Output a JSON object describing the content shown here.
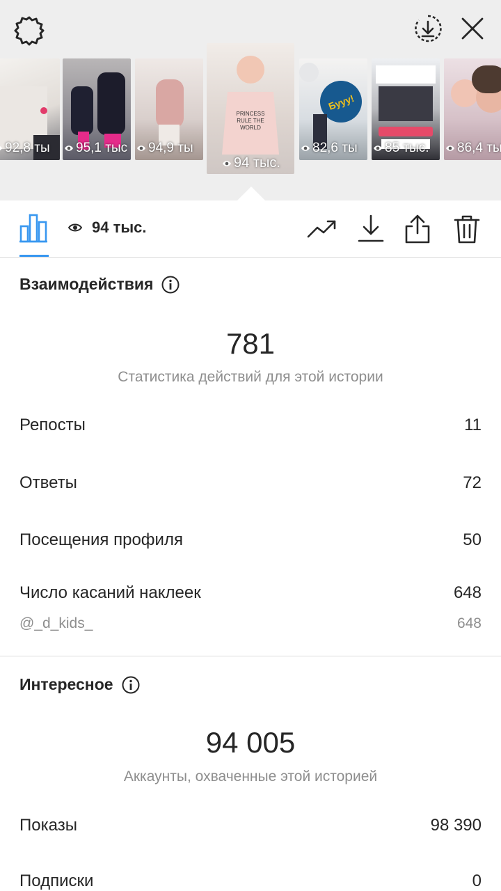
{
  "tray": {
    "stories": [
      {
        "views": "92,8 ты",
        "selected": false
      },
      {
        "views": "95,1 тыс",
        "selected": false
      },
      {
        "views": "94,9 ты",
        "selected": false
      },
      {
        "views": "94 тыс.",
        "selected": true
      },
      {
        "views": "82,6 ты",
        "selected": false
      },
      {
        "views": "85 тыс.",
        "selected": false
      },
      {
        "views": "86,4 ты",
        "selected": false
      }
    ]
  },
  "toolbar": {
    "views_total": "94 тыс."
  },
  "interactions": {
    "title": "Взаимодействия",
    "total": "781",
    "subtitle": "Статистика действий для этой истории",
    "rows": [
      {
        "label": "Репосты",
        "value": "11"
      },
      {
        "label": "Ответы",
        "value": "72"
      },
      {
        "label": "Посещения профиля",
        "value": "50"
      },
      {
        "label": "Число касаний наклеек",
        "value": "648"
      }
    ],
    "sticker": {
      "label": "@_d_kids_",
      "value": "648"
    }
  },
  "discovery": {
    "title": "Интересное",
    "total": "94 005",
    "subtitle": "Аккаунты, охваченные этой историей",
    "rows": [
      {
        "label": "Показы",
        "value": "98 390"
      },
      {
        "label": "Подписки",
        "value": "0"
      }
    ]
  },
  "colors": {
    "accent": "#3897f0",
    "text": "#262626",
    "secondary": "#8e8e8e",
    "tray_bg": "#eeeeee"
  }
}
